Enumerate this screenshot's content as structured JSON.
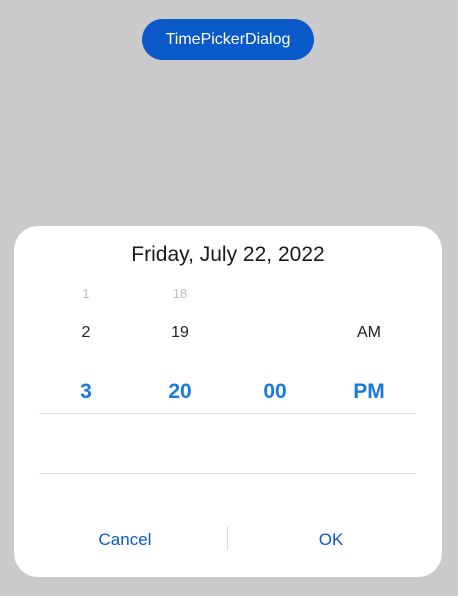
{
  "trigger": {
    "label": "TimePickerDialog"
  },
  "dialog": {
    "date_title": "Friday, July 22, 2022",
    "hour": {
      "far_above": "1",
      "above": "2",
      "selected": "3"
    },
    "minute": {
      "far_above": "18",
      "above": "19",
      "selected": "20"
    },
    "second": {
      "selected": "00"
    },
    "meridiem": {
      "above": "AM",
      "selected": "PM"
    },
    "cancel_label": "Cancel",
    "ok_label": "OK"
  },
  "colors": {
    "background": "#cacaca",
    "accent": "#0a59c8",
    "selected_text": "#1b78e0"
  }
}
